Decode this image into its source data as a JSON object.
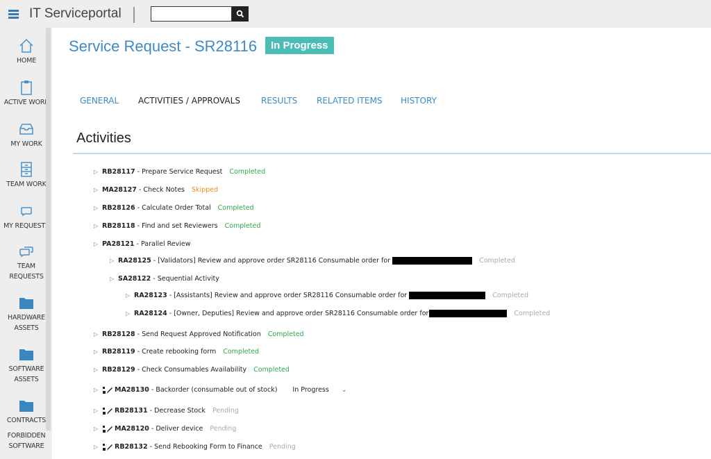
{
  "header": {
    "app_title": "IT Serviceportal",
    "search_placeholder": "",
    "search_value": ""
  },
  "sidebar": {
    "items": [
      {
        "label": "HOME",
        "icon": "home-icon"
      },
      {
        "label": "ACTIVE WORK",
        "icon": "clipboard-icon"
      },
      {
        "label": "MY WORK",
        "icon": "inbox-tray-icon"
      },
      {
        "label": "TEAM WORK",
        "icon": "file-cabinet-icon"
      },
      {
        "label": "MY REQUESTS",
        "icon": "chat-bubble-icon"
      },
      {
        "label": "TEAM REQUESTS",
        "icon": "chat-bubbles-icon"
      },
      {
        "label": "HARDWARE ASSETS",
        "icon": "folder-icon"
      },
      {
        "label": "SOFTWARE ASSETS",
        "icon": "folder-icon"
      },
      {
        "label": "CONTRACTS",
        "icon": "folder-icon"
      },
      {
        "label": "FORBIDDEN SOFTWARE",
        "icon": ""
      }
    ]
  },
  "page": {
    "title": "Service Request - SR28116",
    "status": "In Progress",
    "colors": {
      "accent": "#3d8ac4",
      "badge": "#4bbdb6",
      "completed": "#2ea84a",
      "skipped": "#f0901e",
      "pending": "#aaaaaa"
    }
  },
  "tabs": [
    {
      "label": "GENERAL",
      "active": false
    },
    {
      "label": "ACTIVITIES / APPROVALS",
      "active": true
    },
    {
      "label": "RESULTS",
      "active": false
    },
    {
      "label": "RELATED ITEMS",
      "active": false
    },
    {
      "label": "HISTORY",
      "active": false
    }
  ],
  "section_title": "Activities",
  "activities": [
    {
      "code": "RB28117",
      "name": " - Prepare Service Request",
      "status": "Completed"
    },
    {
      "code": "MA28127",
      "name": " - Check Notes",
      "status": "Skipped"
    },
    {
      "code": "RB28126",
      "name": " - Calculate Order Total",
      "status": "Completed"
    },
    {
      "code": "RB28118",
      "name": " - Find and set Reviewers",
      "status": "Completed"
    },
    {
      "code": "PA28121",
      "name": " - Parallel Review",
      "status": ""
    },
    {
      "code": "RA28125",
      "name": " - [Validators] Review and approve order SR28116 Consumable order for",
      "status": "Completed"
    },
    {
      "code": "SA28122",
      "name": " - Sequential Activity",
      "status": ""
    },
    {
      "code": "RA28123",
      "name": " - [Assistants] Review and approve order SR28116 Consumable order for",
      "status": "Completed"
    },
    {
      "code": "RA28124",
      "name": " - [Owner, Deputies] Review and approve order SR28116 Consumable order for",
      "status": "Completed"
    },
    {
      "code": "RB28128",
      "name": " - Send Request Approved Notification",
      "status": "Completed"
    },
    {
      "code": "RB28119",
      "name": " - Create rebooking form",
      "status": "Completed"
    },
    {
      "code": "RB28129",
      "name": " - Check Consumables Availability",
      "status": "Completed"
    },
    {
      "code": "MA28130",
      "name": " - Backorder (consumable out of stock)",
      "status": "In Progress"
    },
    {
      "code": "RB28131",
      "name": " - Decrease Stock",
      "status": "Pending"
    },
    {
      "code": "MA28120",
      "name": " - Deliver device",
      "status": "Pending"
    },
    {
      "code": "RB28132",
      "name": " - Send Rebooking Form to Finance",
      "status": "Pending"
    }
  ]
}
